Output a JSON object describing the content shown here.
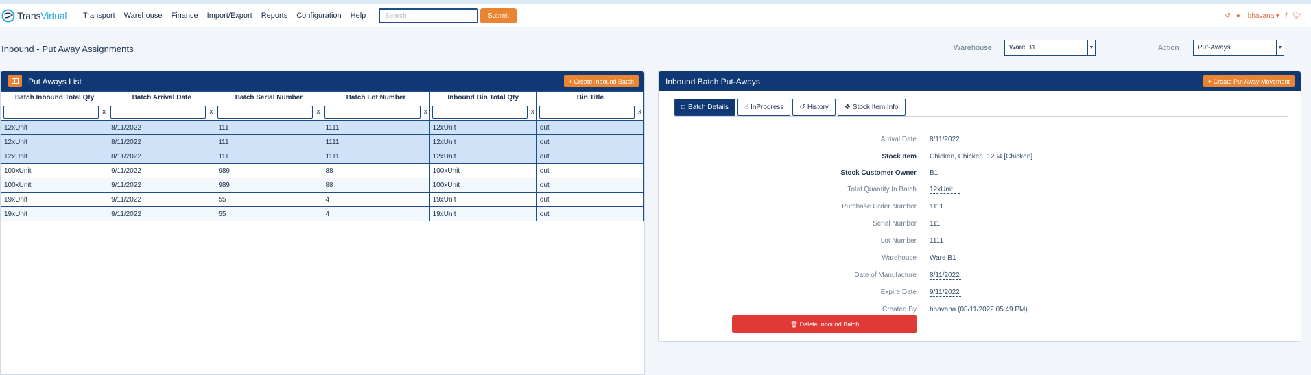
{
  "app": {
    "logo_a": "Trans",
    "logo_b": "Virtual"
  },
  "nav": {
    "items": [
      "Transport",
      "Warehouse",
      "Finance",
      "Import/Export",
      "Reports",
      "Configuration",
      "Help"
    ]
  },
  "search": {
    "placeholder": "Search",
    "value": "",
    "submit": "Submit"
  },
  "user": {
    "name": "bhavana"
  },
  "page": {
    "title": "Inbound - Put Away Assignments"
  },
  "filters": {
    "warehouse_label": "Warehouse",
    "warehouse_value": "Ware B1",
    "action_label": "Action",
    "action_value": "Put-Aways"
  },
  "left_panel": {
    "title": "Put Aways List",
    "create_button": "+ Create Inbound Batch",
    "columns": [
      "Batch Inbound Total Qty",
      "Batch Arrival Date",
      "Batch Serial Number",
      "Batch Lot Number",
      "Inbound Bin Total Qty",
      "Bin Title"
    ],
    "clear_label": "x",
    "rows": [
      [
        "12xUnit",
        "8/11/2022",
        "111",
        "1111",
        "12xUnit",
        "out"
      ],
      [
        "12xUnit",
        "8/11/2022",
        "111",
        "1111",
        "12xUnit",
        "out"
      ],
      [
        "12xUnit",
        "8/11/2022",
        "111",
        "1111",
        "12xUnit",
        "out"
      ],
      [
        "100xUnit",
        "9/11/2022",
        "989",
        "88",
        "100xUnit",
        "out"
      ],
      [
        "100xUnit",
        "9/11/2022",
        "989",
        "88",
        "100xUnit",
        "out"
      ],
      [
        "19xUnit",
        "9/11/2022",
        "55",
        "4",
        "19xUnit",
        "out"
      ],
      [
        "19xUnit",
        "9/11/2022",
        "55",
        "4",
        "19xUnit",
        "out"
      ]
    ]
  },
  "right_panel": {
    "title": "Inbound Batch Put-Aways",
    "create_button": "+ Create Put Away Movement",
    "tabs": [
      "Batch Details",
      "InProgress",
      "History",
      "Stock Item Info"
    ],
    "details": {
      "arrival_date_label": "Arrival Date",
      "arrival_date": "8/11/2022",
      "stock_item_label": "Stock Item",
      "stock_item": "Chicken, Chicken, 1234 [Chicken]",
      "owner_label": "Stock Customer Owner",
      "owner": "B1",
      "total_qty_label": "Total Quantity In Batch",
      "total_qty": "12xUnit",
      "po_label": "Purchase Order Number",
      "po": "1111",
      "serial_label": "Serial Number",
      "serial": "111",
      "lot_label": "Lot Number",
      "lot": "1111",
      "warehouse_label": "Warehouse",
      "warehouse": "Ware B1",
      "dom_label": "Date of Manufacture",
      "dom": "8/11/2022",
      "expire_label": "Expire Date",
      "expire": "9/11/2022",
      "created_by_label": "Created By",
      "created_by": "bhavana (08/11/2022 05:49 PM)"
    },
    "delete_button": "Delete Inbound Batch"
  },
  "colors": {
    "navy": "#0f3874",
    "orange": "#e88432",
    "red": "#e03a36",
    "selected_row": "#cfe2f8"
  }
}
